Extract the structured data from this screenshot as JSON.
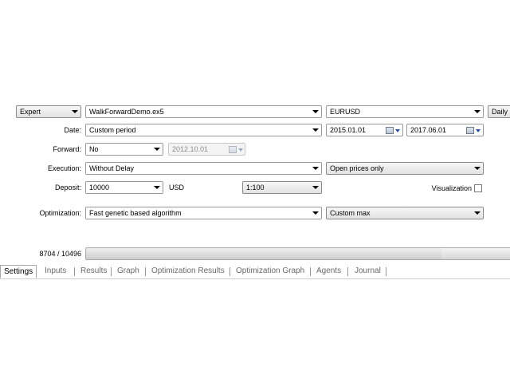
{
  "row1": {
    "expert_label": "Expert",
    "expert_file": "WalkForwardDemo.ex5",
    "symbol": "EURUSD",
    "period": "Daily"
  },
  "date": {
    "label": "Date:",
    "mode": "Custom period",
    "from": "2015.01.01",
    "to": "2017.06.01"
  },
  "forward": {
    "label": "Forward:",
    "value": "No",
    "date": "2012.10.01"
  },
  "execution": {
    "label": "Execution:",
    "value": "Without Delay",
    "model": "Open prices only"
  },
  "deposit": {
    "label": "Deposit:",
    "amount": "10000",
    "currency": "USD",
    "leverage": "1:100",
    "visualization_label": "Visualization",
    "visualization_checked": false
  },
  "optimization": {
    "label": "Optimization:",
    "algorithm": "Fast genetic based algorithm",
    "criterion": "Custom max"
  },
  "progress": {
    "text": "8704 / 10496",
    "fraction": 0.8293
  },
  "tabs": [
    {
      "label": "Settings",
      "active": true
    },
    {
      "label": "Inputs"
    },
    {
      "label": "Results"
    },
    {
      "label": "Graph"
    },
    {
      "label": "Optimization Results"
    },
    {
      "label": "Optimization Graph"
    },
    {
      "label": "Agents"
    },
    {
      "label": "Journal"
    }
  ]
}
